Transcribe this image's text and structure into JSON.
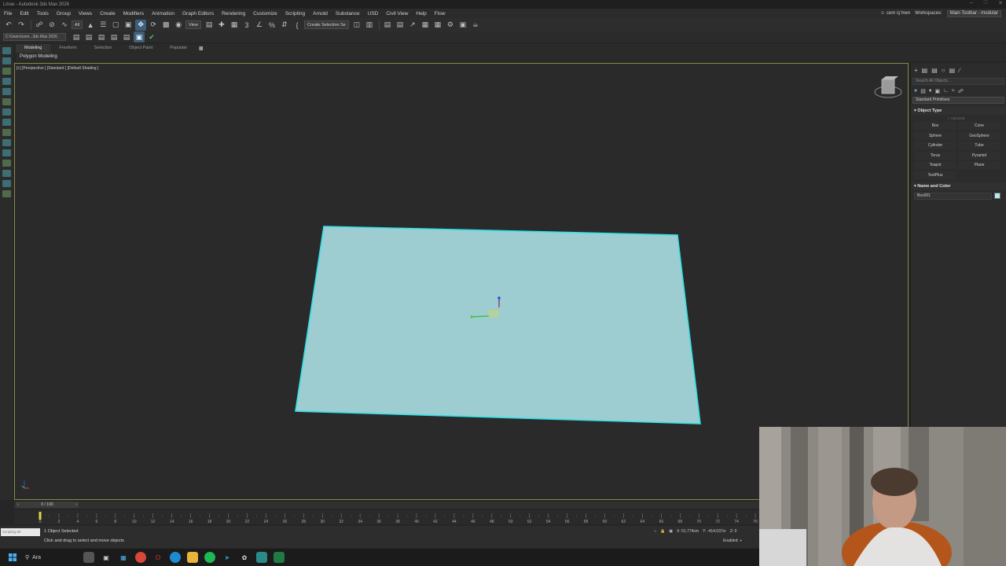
{
  "titlebar": {
    "title": "Lmax - Autodesk 3ds Max 2026",
    "window_controls": [
      "–",
      "□",
      "✕"
    ]
  },
  "menubar": {
    "items": [
      "File",
      "Edit",
      "Tools",
      "Group",
      "Views",
      "Create",
      "Modifiers",
      "Animation",
      "Graph Editors",
      "Rendering",
      "Customize",
      "Scripting",
      "Arnold",
      "Substance",
      "USD",
      "Civil View",
      "Help",
      "Flow"
    ],
    "user": "cem iş'men",
    "workspaces_label": "Workspaces:",
    "workspace": "Main Toolbar - modular"
  },
  "toolbar": {
    "filter_select": "All",
    "refcoord_select": "View",
    "named_selection": "Create Selection Se"
  },
  "toolbar2": {
    "project_path": "C:\\Users\\cem...3ds Max 2026"
  },
  "ribbon": {
    "tabs": [
      "Modeling",
      "Freeform",
      "Selection",
      "Object Paint",
      "Populate"
    ],
    "active_tab": "Modeling",
    "sub_label": "Polygon Modeling"
  },
  "viewport": {
    "label": "[+] [Perspective ] [Standard ] [Default Shading ]",
    "plane_color": "#9ecdd1",
    "selection_color": "#33e0e8",
    "background": "#2a2a2a"
  },
  "command_panel": {
    "search_placeholder": "Search All Objects...",
    "category": "Standard Primitives",
    "object_type_title": "Object Type",
    "autogrid_label": "AutoGrid",
    "primitives": [
      "Box",
      "Cone",
      "Sphere",
      "GeoSphere",
      "Cylinder",
      "Tube",
      "Torus",
      "Pyramid",
      "Teapot",
      "Plane",
      "TextPlus"
    ],
    "name_color_title": "Name and Color",
    "object_name": "Box001",
    "object_color": "#b6ecee"
  },
  "timeline": {
    "frame_display": "0 / 100",
    "ticks": [
      "0",
      "2",
      "4",
      "6",
      "8",
      "10",
      "12",
      "14",
      "16",
      "18",
      "20",
      "22",
      "24",
      "26",
      "28",
      "30",
      "32",
      "34",
      "36",
      "38",
      "40",
      "42",
      "44",
      "46",
      "48",
      "50",
      "52",
      "54",
      "56",
      "58",
      "60",
      "62",
      "64",
      "66",
      "68",
      "70",
      "72",
      "74",
      "76"
    ]
  },
  "status": {
    "script_placeholder": "Scripting Mi",
    "selection_status": "1 Object Selected",
    "prompt": "Click and drag to select and move objects",
    "x_value": "X: 51,774cm",
    "y_value": "Y: -414,037cr",
    "z_value": "Z: 0",
    "enabled_label": "Enabled:"
  },
  "taskbar": {
    "search_label": "Ara"
  }
}
